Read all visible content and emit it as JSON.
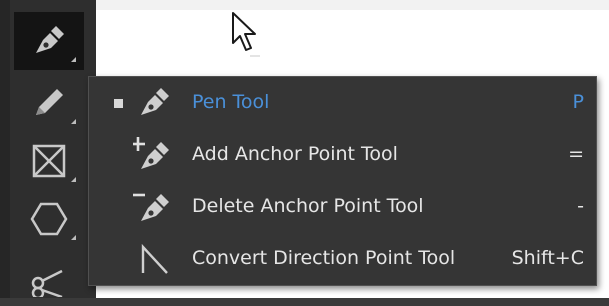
{
  "toolbar": {
    "tools": [
      {
        "name": "pen-tool",
        "selected": true
      },
      {
        "name": "pencil-tool",
        "selected": false
      },
      {
        "name": "rectangle-frame-tool",
        "selected": false
      },
      {
        "name": "polygon-tool",
        "selected": false
      },
      {
        "name": "scissors-tool",
        "selected": false
      }
    ]
  },
  "flyout": {
    "items": [
      {
        "label": "Pen Tool",
        "shortcut": "P",
        "icon": "pen-icon",
        "active": true
      },
      {
        "label": "Add Anchor Point Tool",
        "shortcut": "=",
        "icon": "add-anchor-point-icon",
        "active": false
      },
      {
        "label": "Delete Anchor Point Tool",
        "shortcut": "-",
        "icon": "delete-anchor-point-icon",
        "active": false
      },
      {
        "label": "Convert Direction Point Tool",
        "shortcut": "Shift+C",
        "icon": "convert-direction-point-icon",
        "active": false
      }
    ]
  },
  "colors": {
    "accent": "#4a90d9",
    "panel": "#353535",
    "toolbar": "#2e2e2e",
    "text": "#e6e6e6"
  }
}
